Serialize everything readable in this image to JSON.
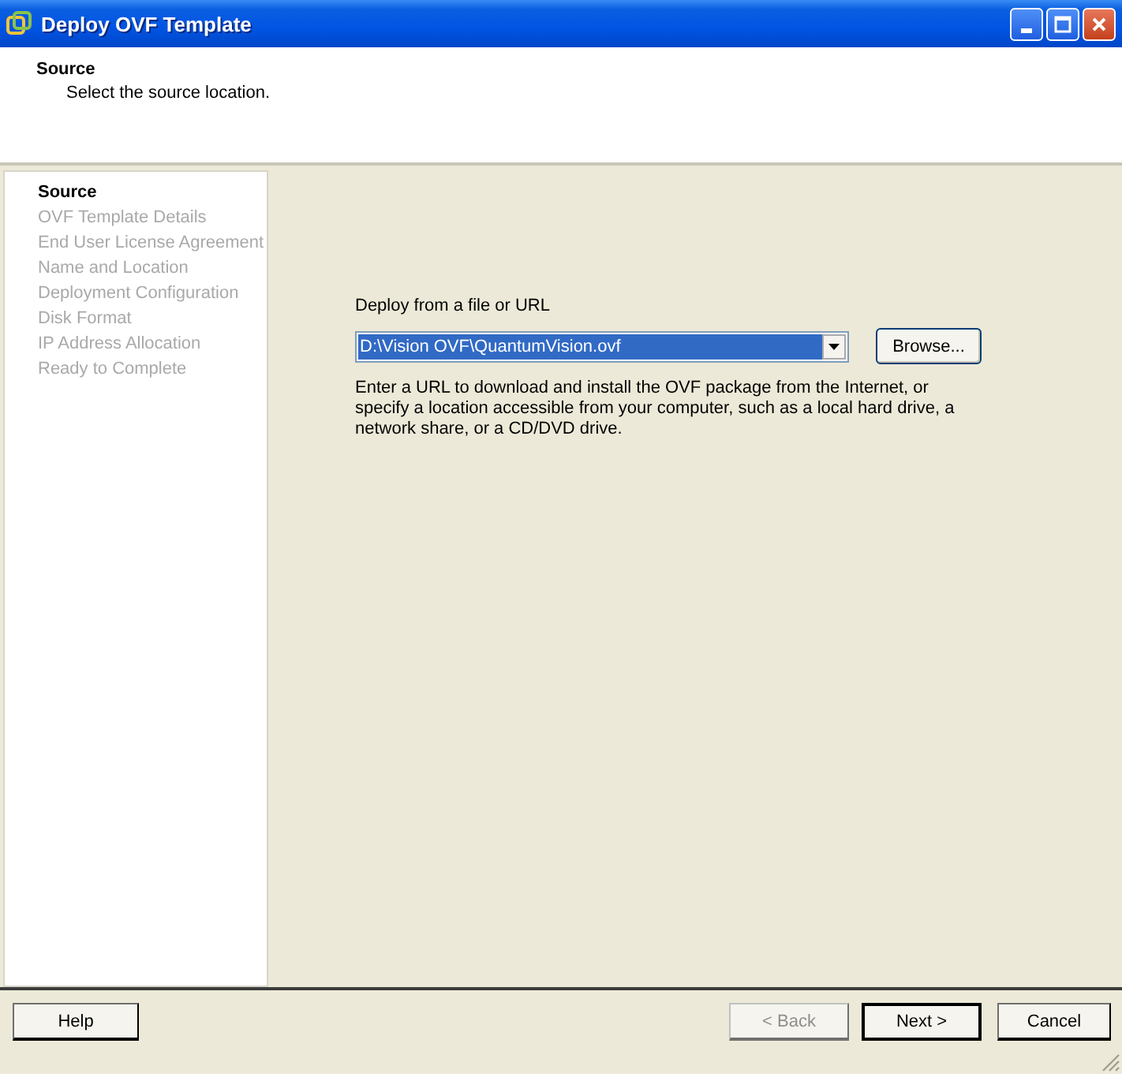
{
  "window": {
    "title": "Deploy OVF Template"
  },
  "header": {
    "title": "Source",
    "subtitle": "Select the source location."
  },
  "steps": [
    {
      "label": "Source",
      "selected": true
    },
    {
      "label": "OVF Template Details",
      "selected": false
    },
    {
      "label": "End User License Agreement",
      "selected": false
    },
    {
      "label": "Name and Location",
      "selected": false
    },
    {
      "label": "Deployment Configuration",
      "selected": false
    },
    {
      "label": "Disk Format",
      "selected": false
    },
    {
      "label": "IP Address Allocation",
      "selected": false
    },
    {
      "label": "Ready to Complete",
      "selected": false
    }
  ],
  "source": {
    "label": "Deploy from a file or URL",
    "value": "D:\\Vision OVF\\QuantumVision.ovf",
    "value_selected": true,
    "browse": "Browse...",
    "hint": "Enter a URL to download and install the OVF package from the Internet, or specify a location accessible from your computer, such as a local hard drive, a network share, or a CD/DVD drive."
  },
  "buttons": [
    {
      "label": "Help",
      "kind": "help",
      "disabled": false,
      "default": false
    },
    {
      "label": "< Back",
      "kind": "nav",
      "disabled": true,
      "default": false
    },
    {
      "label": "Next >",
      "kind": "nav",
      "disabled": false,
      "default": true
    },
    {
      "label": "Cancel",
      "kind": "cancel",
      "disabled": false,
      "default": false
    }
  ]
}
